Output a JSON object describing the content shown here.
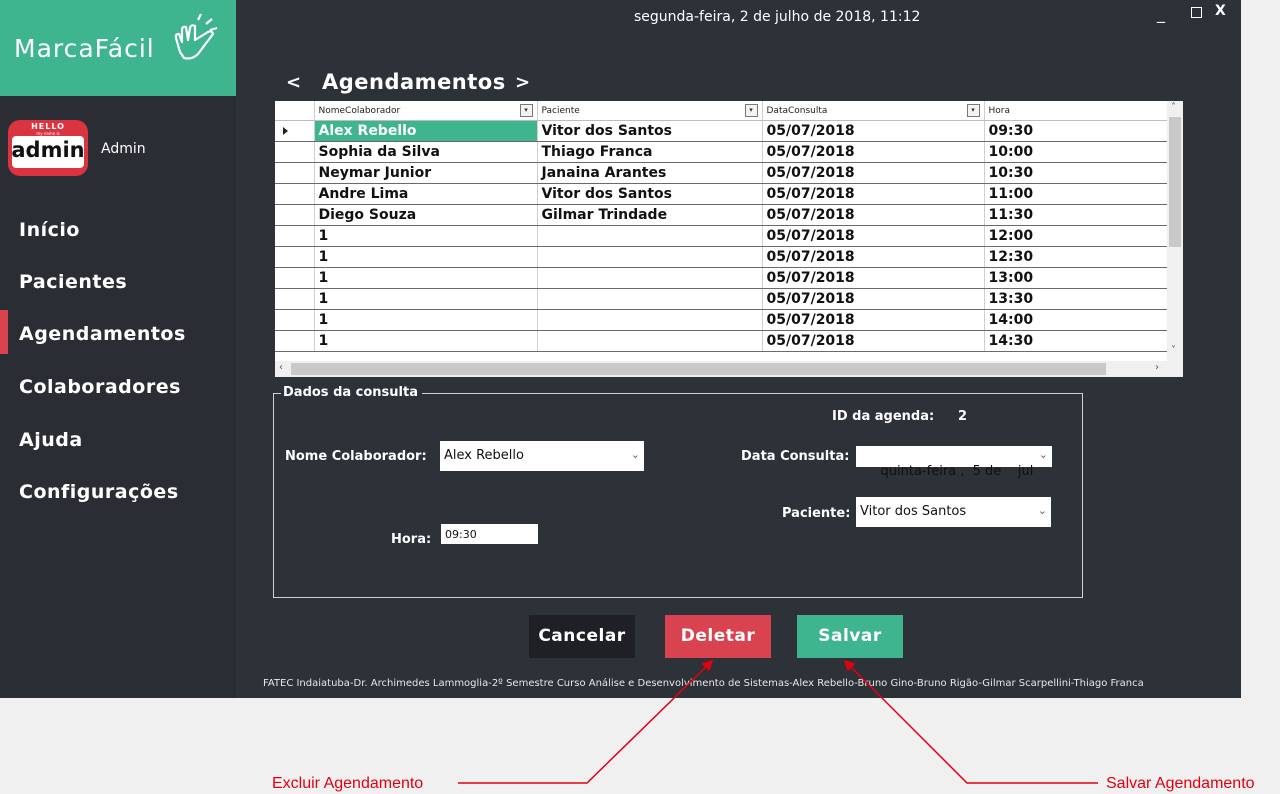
{
  "app": {
    "logo_text": "MarcaFácil",
    "datetime": "segunda-feira, 2 de julho de 2018, 11:12",
    "window_controls": {
      "minimize": "_",
      "maximize_icon": "square-icon",
      "close": "X"
    }
  },
  "user": {
    "badge_hello": "HELLO",
    "badge_sub": "my name is",
    "badge_name": "admin",
    "name": "Admin"
  },
  "sidebar": {
    "items": [
      {
        "label": "Início",
        "active": false
      },
      {
        "label": "Pacientes",
        "active": false
      },
      {
        "label": "Agendamentos",
        "active": true
      },
      {
        "label": "Colaboradores",
        "active": false
      },
      {
        "label": "Ajuda",
        "active": false
      },
      {
        "label": "Configurações",
        "active": false
      }
    ]
  },
  "page": {
    "prev": "<",
    "title": "Agendamentos",
    "next": ">"
  },
  "grid": {
    "columns": [
      "NomeColaborador",
      "Paciente",
      "DataConsulta",
      "Hora"
    ],
    "selected_row": 0,
    "rows": [
      [
        "Alex Rebello",
        "Vitor dos Santos",
        "05/07/2018",
        "09:30"
      ],
      [
        "Sophia da Silva",
        "Thiago Franca",
        "05/07/2018",
        "10:00"
      ],
      [
        "Neymar Junior",
        "Janaina Arantes",
        "05/07/2018",
        "10:30"
      ],
      [
        "Andre Lima",
        "Vitor dos Santos",
        "05/07/2018",
        "11:00"
      ],
      [
        "Diego Souza",
        "Gilmar Trindade",
        "05/07/2018",
        "11:30"
      ],
      [
        "1",
        "",
        "05/07/2018",
        "12:00"
      ],
      [
        "1",
        "",
        "05/07/2018",
        "12:30"
      ],
      [
        "1",
        "",
        "05/07/2018",
        "13:00"
      ],
      [
        "1",
        "",
        "05/07/2018",
        "13:30"
      ],
      [
        "1",
        "",
        "05/07/2018",
        "14:00"
      ],
      [
        "1",
        "",
        "05/07/2018",
        "14:30"
      ]
    ]
  },
  "form": {
    "group_title": "Dados da consulta",
    "id_label": "ID da agenda:",
    "id_value": "2",
    "colaborador_label": "Nome Colaborador:",
    "colaborador_value": "Alex Rebello",
    "data_label": "Data Consulta:",
    "data_value": "quinta-feira ,  5 de    jul",
    "paciente_label": "Paciente:",
    "paciente_value": "Vitor dos Santos",
    "hora_label": "Hora:",
    "hora_value": "09:30"
  },
  "buttons": {
    "cancel": "Cancelar",
    "delete": "Deletar",
    "save": "Salvar"
  },
  "footer": "FATEC Indaiatuba-Dr. Archimedes Lammoglia-2º Semestre Curso Análise e Desenvolvimento de Sistemas-Alex Rebello-Bruno Gino-Bruno Rigão-Gilmar Scarpellini-Thiago Franca",
  "annotations": {
    "delete": "Excluir Agendamento",
    "save": "Salvar Agendamento"
  },
  "colors": {
    "accent": "#3fb58f",
    "danger": "#d9434f",
    "background": "#2d3138",
    "sidebar": "#2a2d33",
    "annotation": "#e3000f"
  }
}
